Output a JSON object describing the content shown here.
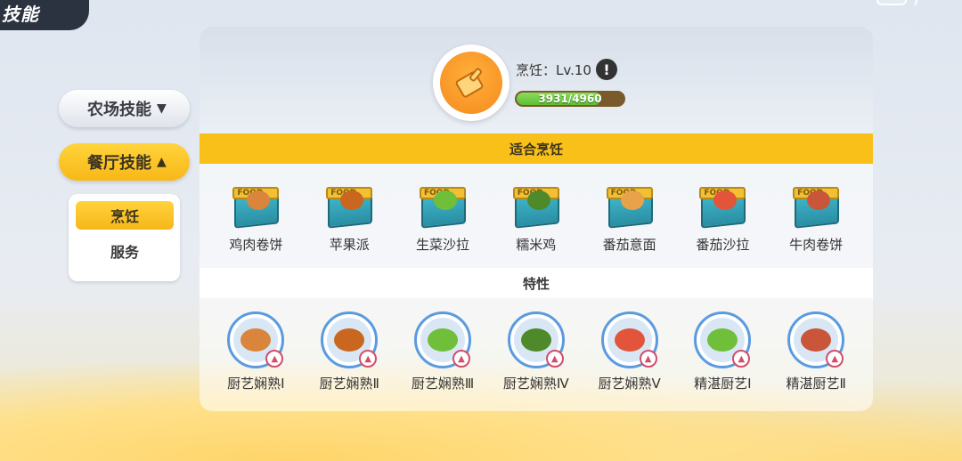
{
  "header": {
    "title": "技能"
  },
  "nav": {
    "farm_label": "农场技能",
    "restaurant_label": "餐厅技能",
    "sub_items": [
      {
        "label": "烹饪",
        "selected": true
      },
      {
        "label": "服务",
        "selected": false
      }
    ]
  },
  "skill": {
    "name": "烹饪：Lv.10",
    "info": "!",
    "xp_text": "3931/4960",
    "xp_current": 3931,
    "xp_max": 4960,
    "icon": "cutting-board-icon"
  },
  "sections": {
    "dishes_title": "适合烹饪",
    "traits_title": "特性"
  },
  "food_box_label": "FOOD",
  "dishes": [
    {
      "label": "鸡肉卷饼",
      "color": "#d9853b"
    },
    {
      "label": "苹果派",
      "color": "#c9661f"
    },
    {
      "label": "生菜沙拉",
      "color": "#6fbf3a"
    },
    {
      "label": "糯米鸡",
      "color": "#4f8a2a"
    },
    {
      "label": "番茄意面",
      "color": "#e8a24a"
    },
    {
      "label": "番茄沙拉",
      "color": "#e3553a"
    },
    {
      "label": "牛肉卷饼",
      "color": "#c9563a"
    }
  ],
  "traits": [
    {
      "label": "厨艺娴熟Ⅰ",
      "color": "#d9853b"
    },
    {
      "label": "厨艺娴熟Ⅱ",
      "color": "#c9661f"
    },
    {
      "label": "厨艺娴熟Ⅲ",
      "color": "#6fbf3a"
    },
    {
      "label": "厨艺娴熟Ⅳ",
      "color": "#4f8a2a"
    },
    {
      "label": "厨艺娴熟Ⅴ",
      "color": "#e3553a"
    },
    {
      "label": "精湛厨艺Ⅰ",
      "color": "#6fbf3a"
    },
    {
      "label": "精湛厨艺Ⅱ",
      "color": "#c9563a"
    }
  ],
  "colors": {
    "accent": "#f8c019",
    "xp_green": "#5cbf33",
    "plate_ring": "#5a9be0"
  }
}
